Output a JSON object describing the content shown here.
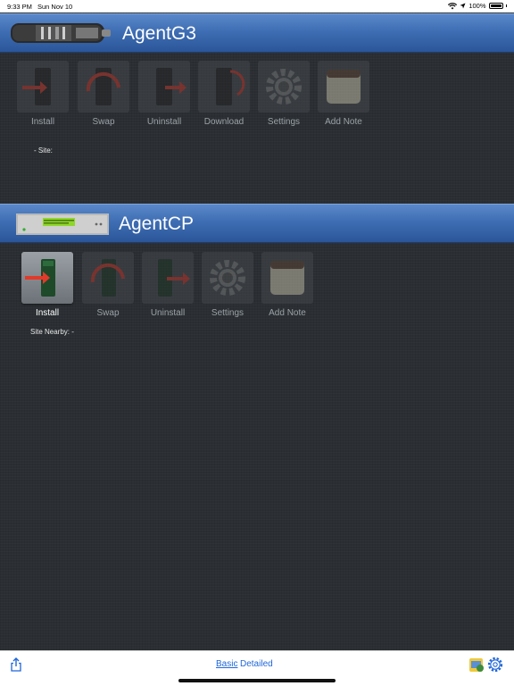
{
  "status_bar": {
    "time": "9:33 PM",
    "date": "Sun Nov 10",
    "battery": "100%"
  },
  "agent_g3": {
    "title": "AgentG3",
    "device_icon": "flashlight-device-icon",
    "tools": [
      {
        "label": "Install",
        "icon": "install-icon"
      },
      {
        "label": "Swap",
        "icon": "swap-icon"
      },
      {
        "label": "Uninstall",
        "icon": "uninstall-icon"
      },
      {
        "label": "Download",
        "icon": "download-icon"
      },
      {
        "label": "Settings",
        "icon": "gear-icon"
      },
      {
        "label": "Add Note",
        "icon": "note-icon"
      }
    ],
    "site_text": "-  Site:"
  },
  "agent_cp": {
    "title": "AgentCP",
    "device_icon": "rack-device-icon",
    "tools": [
      {
        "label": "Install",
        "icon": "install-icon",
        "active": true
      },
      {
        "label": "Swap",
        "icon": "swap-icon"
      },
      {
        "label": "Uninstall",
        "icon": "uninstall-icon"
      },
      {
        "label": "Settings",
        "icon": "gear-icon"
      },
      {
        "label": "Add Note",
        "icon": "note-icon"
      }
    ],
    "site_text": "Site Nearby:  -"
  },
  "bottom_bar": {
    "share_icon": "share-icon",
    "basic_label": "Basic",
    "detailed_label": "Detailed",
    "settings_icon": "gear-icon",
    "app_icon": "app-badge-icon"
  },
  "colors": {
    "header_blue": "#3f6eb4",
    "arrow_red": "#e23a2a",
    "link_blue": "#1f66d9"
  }
}
